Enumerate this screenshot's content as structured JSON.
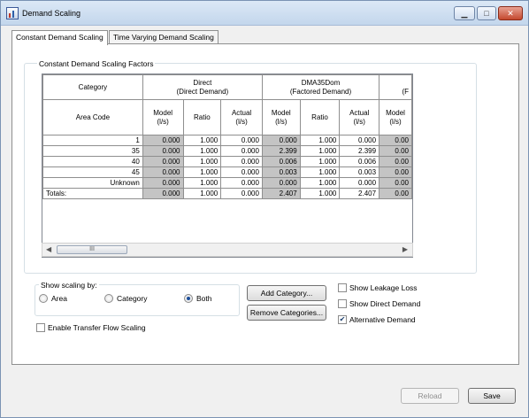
{
  "window": {
    "title": "Demand Scaling",
    "minimize_glyph": "▁",
    "maximize_glyph": "□",
    "close_glyph": "✕"
  },
  "tabs": [
    {
      "label": "Constant Demand Scaling",
      "active": true
    },
    {
      "label": "Time Varying Demand Scaling",
      "active": false
    }
  ],
  "factors_group": {
    "title": "Constant Demand Scaling Factors"
  },
  "grid": {
    "category_label": "Category",
    "area_code_label": "Area Code",
    "categories": [
      {
        "name": "Direct",
        "sub": "(Direct Demand)"
      },
      {
        "name": "DMA35Dom",
        "sub": "(Factored Demand)"
      },
      {
        "name": "",
        "sub": "(F"
      }
    ],
    "col_headers": {
      "model": "Model",
      "model_unit": "(l/s)",
      "ratio": "Ratio",
      "actual": "Actual",
      "actual_unit": "(l/s)"
    },
    "rows": [
      {
        "area": "1",
        "d_model": "0.000",
        "d_ratio": "1.000",
        "d_actual": "0.000",
        "m_model": "0.000",
        "m_ratio": "1.000",
        "m_actual": "0.000",
        "x_model": "0.00"
      },
      {
        "area": "35",
        "d_model": "0.000",
        "d_ratio": "1.000",
        "d_actual": "0.000",
        "m_model": "2.399",
        "m_ratio": "1.000",
        "m_actual": "2.399",
        "x_model": "0.00"
      },
      {
        "area": "40",
        "d_model": "0.000",
        "d_ratio": "1.000",
        "d_actual": "0.000",
        "m_model": "0.006",
        "m_ratio": "1.000",
        "m_actual": "0.006",
        "x_model": "0.00"
      },
      {
        "area": "45",
        "d_model": "0.000",
        "d_ratio": "1.000",
        "d_actual": "0.000",
        "m_model": "0.003",
        "m_ratio": "1.000",
        "m_actual": "0.003",
        "x_model": "0.00"
      },
      {
        "area": "Unknown",
        "d_model": "0.000",
        "d_ratio": "1.000",
        "d_actual": "0.000",
        "m_model": "0.000",
        "m_ratio": "1.000",
        "m_actual": "0.000",
        "x_model": "0.00"
      }
    ],
    "totals": {
      "label": "Totals:",
      "d_model": "0.000",
      "d_ratio": "1.000",
      "d_actual": "0.000",
      "m_model": "2.407",
      "m_ratio": "1.000",
      "m_actual": "2.407",
      "x_model": "0.00"
    },
    "scroll": {
      "left_arrow": "◀",
      "right_arrow": "▶",
      "thumb_grip": "III"
    }
  },
  "scaling": {
    "title": "Show scaling by:",
    "options": [
      {
        "label": "Area",
        "checked": false
      },
      {
        "label": "Category",
        "checked": false
      },
      {
        "label": "Both",
        "checked": true
      }
    ]
  },
  "buttons": {
    "add_category": "Add Category...",
    "remove_categories": "Remove Categories...",
    "reload": "Reload",
    "save": "Save"
  },
  "checks": {
    "show_leakage_loss": {
      "label": "Show Leakage Loss",
      "checked": false
    },
    "show_direct_demand": {
      "label": "Show Direct Demand",
      "checked": false
    },
    "alternative_demand": {
      "label": "Alternative Demand",
      "checked": true
    },
    "enable_transfer_flow": {
      "label": "Enable Transfer Flow Scaling",
      "checked": false
    },
    "checkmark_glyph": "✔"
  }
}
